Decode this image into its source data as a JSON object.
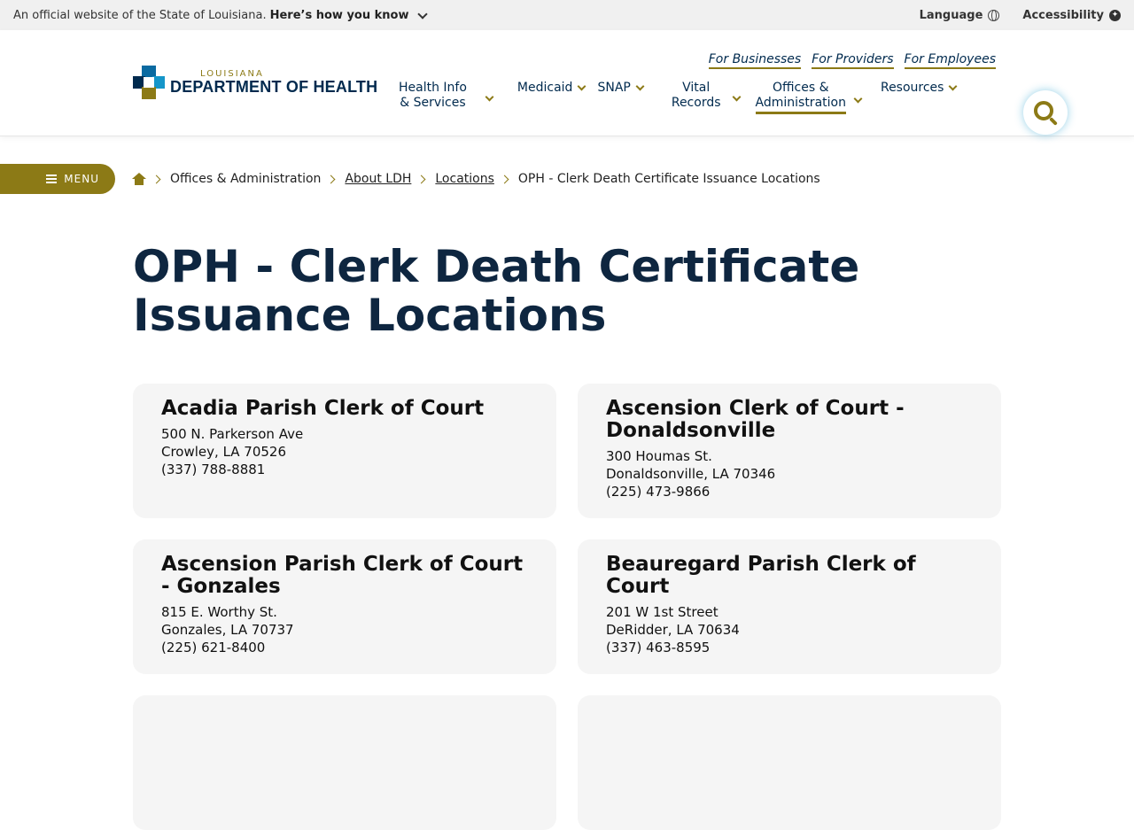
{
  "banner": {
    "official_text": "An official website of the State of Louisiana.",
    "how_know": "Here’s how you know",
    "language": "Language",
    "accessibility": "Accessibility"
  },
  "logo": {
    "small": "LOUISIANA",
    "big": "DEPARTMENT OF HEALTH"
  },
  "audience_links": [
    "For Businesses",
    "For Providers",
    "For Employees"
  ],
  "nav": {
    "items": [
      {
        "label": "Health Info\n& Services"
      },
      {
        "label": "Medicaid"
      },
      {
        "label": "SNAP"
      },
      {
        "label": "Vital\nRecords"
      },
      {
        "label": "Offices &\nAdministration",
        "active": true
      },
      {
        "label": "Resources"
      }
    ],
    "search_icon": "search-icon"
  },
  "menu": {
    "label": "MENU"
  },
  "breadcrumb": {
    "items": [
      "Offices & Administration",
      "About LDH",
      "Locations",
      "OPH - Clerk Death Certificate Issuance Locations"
    ]
  },
  "page": {
    "title": "OPH - Clerk Death Certificate Issuance Locations"
  },
  "locations": [
    {
      "name": "Acadia Parish Clerk of Court",
      "street": "500 N. Parkerson Ave",
      "city": "Crowley, LA 70526",
      "phone": "(337) 788-8881"
    },
    {
      "name": "Ascension Clerk of Court - Donaldsonville",
      "street": "300 Houmas St.",
      "city": "Donaldsonville, LA 70346",
      "phone": "(225) 473-9866"
    },
    {
      "name": "Ascension Parish Clerk of Court - Gonzales",
      "street": "815 E. Worthy St.",
      "city": "Gonzales, LA 70737",
      "phone": "(225) 621-8400"
    },
    {
      "name": "Beauregard Parish Clerk of Court",
      "street": "201 W 1st Street",
      "city": "DeRidder, LA 70634",
      "phone": "(337) 463-8595"
    }
  ],
  "colors": {
    "navy": "#002a4e",
    "gold": "#8c7a16",
    "card_bg": "#f5f5f5"
  }
}
